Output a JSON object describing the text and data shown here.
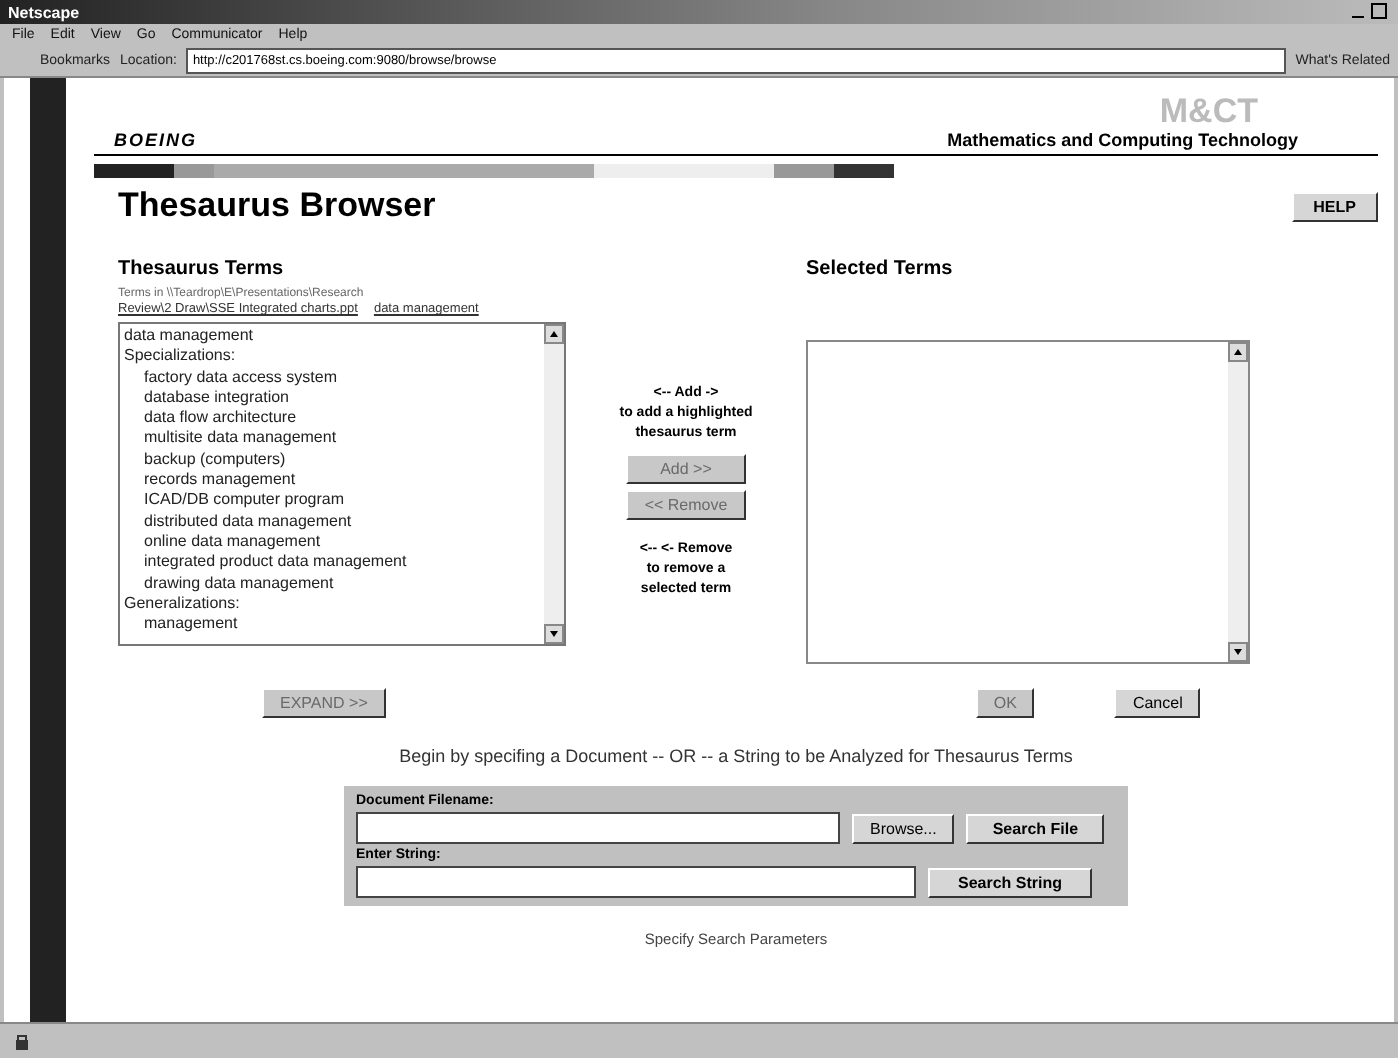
{
  "window": {
    "title": "Netscape"
  },
  "menu": [
    "File",
    "Edit",
    "View",
    "Go",
    "Communicator",
    "Help"
  ],
  "location_bar": {
    "bookmarks": "Bookmarks",
    "label": "Location:",
    "url": "http://c201768st.cs.boeing.com:9080/browse/browse",
    "related": "What's Related"
  },
  "header": {
    "logo": "BOEING",
    "tagline": "Mathematics and Computing Technology",
    "watermark": "M&CT"
  },
  "page_title": "Thesaurus Browser",
  "help_button": "HELP",
  "terms": {
    "heading": "Thesaurus Terms",
    "path": "Terms in \\\\Teardrop\\E\\Presentations\\Research",
    "links": [
      "Review\\2 Draw\\SSE Integrated charts.ppt",
      "data management"
    ],
    "items": [
      {
        "text": "data management",
        "indented": false
      },
      {
        "text": "Specializations:",
        "indented": false
      },
      {
        "text": "factory data access system",
        "indented": true
      },
      {
        "text": "database integration",
        "indented": true
      },
      {
        "text": "data flow architecture",
        "indented": true
      },
      {
        "text": "multisite data management",
        "indented": true
      },
      {
        "text": "backup (computers)",
        "indented": true
      },
      {
        "text": "records management",
        "indented": true
      },
      {
        "text": "ICAD/DB computer program",
        "indented": true
      },
      {
        "text": "distributed data management",
        "indented": true
      },
      {
        "text": "online data management",
        "indented": true
      },
      {
        "text": "integrated product data management",
        "indented": true
      },
      {
        "text": "drawing data management",
        "indented": true
      },
      {
        "text": "Generalizations:",
        "indented": false
      },
      {
        "text": "management",
        "indented": true
      }
    ]
  },
  "add_hint": [
    "<-- Add ->",
    "to add a highlighted",
    "thesaurus term"
  ],
  "add_button": {
    "label": "Add >>",
    "disabled": true
  },
  "remove_button": {
    "label": "<< Remove",
    "disabled": true
  },
  "remove_hint": [
    "<-- <- Remove",
    "to remove a",
    "selected term"
  ],
  "selected": {
    "heading": "Selected Terms"
  },
  "expand_button": {
    "label": "EXPAND >>",
    "disabled": true
  },
  "ok_button": {
    "label": "OK",
    "disabled": true
  },
  "cancel_button": {
    "label": "Cancel",
    "disabled": false
  },
  "instruction": "Begin by specifing a Document -- OR -- a String to be Analyzed for Thesaurus Terms",
  "form": {
    "file_label": "Document Filename:",
    "browse": "Browse...",
    "search_file": "Search File",
    "string_label": "Enter String:",
    "search_string": "Search String"
  },
  "footer": "Specify Search Parameters"
}
